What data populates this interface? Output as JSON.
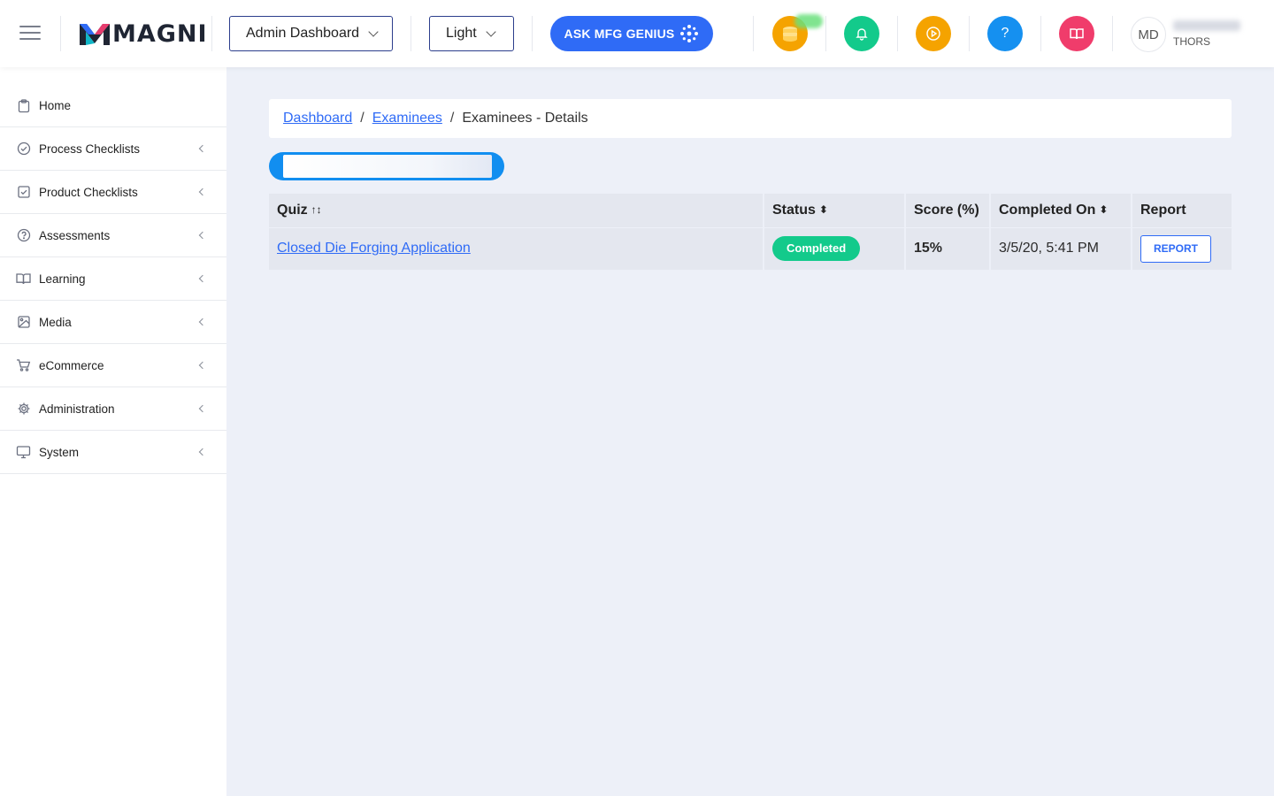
{
  "header": {
    "logo_text": "MAGNI",
    "dashboard_select": "Admin Dashboard",
    "theme_select": "Light",
    "ask_button": "ASK MFG GENIUS",
    "user": {
      "initials": "MD",
      "company": "THORS"
    },
    "icons": {
      "coins": "coins-icon",
      "bell": "bell-icon",
      "play": "play-circle-icon",
      "help": "question-icon",
      "book": "book-icon"
    },
    "colors": {
      "coins": "#f5a300",
      "bell": "#13ca8b",
      "play": "#f5a300",
      "help": "#1590f0",
      "book": "#f03c6b",
      "ask": "#2f6bf6"
    }
  },
  "sidebar": {
    "items": [
      {
        "label": "Home",
        "icon": "clipboard-icon",
        "expandable": false
      },
      {
        "label": "Process Checklists",
        "icon": "check-circle-icon",
        "expandable": true
      },
      {
        "label": "Product Checklists",
        "icon": "check-square-icon",
        "expandable": true
      },
      {
        "label": "Assessments",
        "icon": "help-circle-icon",
        "expandable": true
      },
      {
        "label": "Learning",
        "icon": "book-open-icon",
        "expandable": true
      },
      {
        "label": "Media",
        "icon": "image-icon",
        "expandable": true
      },
      {
        "label": "eCommerce",
        "icon": "cart-icon",
        "expandable": true
      },
      {
        "label": "Administration",
        "icon": "settings-icon",
        "expandable": true
      },
      {
        "label": "System",
        "icon": "monitor-icon",
        "expandable": true
      }
    ]
  },
  "breadcrumb": {
    "items": [
      "Dashboard",
      "Examinees"
    ],
    "current": "Examinees - Details",
    "separator": "/"
  },
  "table": {
    "columns": [
      "Quiz",
      "Status",
      "Score (%)",
      "Completed On",
      "Report"
    ],
    "rows": [
      {
        "quiz": "Closed Die Forging Application",
        "status": "Completed",
        "score": "15%",
        "completed_on": "3/5/20, 5:41 PM",
        "report": "REPORT"
      }
    ]
  },
  "status_colors": {
    "completed": "#13ca8b"
  }
}
